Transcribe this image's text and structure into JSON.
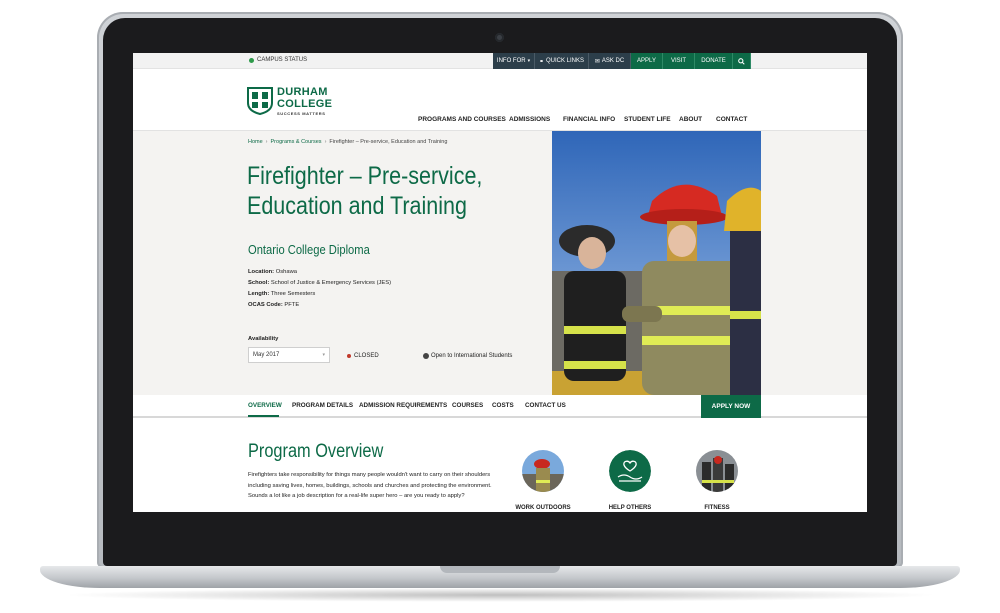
{
  "utility": {
    "campus_status": "CAMPUS STATUS",
    "info_for": "INFO FOR",
    "quick_links": "QUICK LINKS",
    "ask_dc": "ASK DC",
    "apply": "APPLY",
    "visit": "VISIT",
    "donate": "DONATE"
  },
  "logo": {
    "line1": "DURHAM",
    "line2": "COLLEGE",
    "tagline": "SUCCESS MATTERS"
  },
  "nav": {
    "items": [
      "PROGRAMS AND COURSES",
      "ADMISSIONS",
      "FINANCIAL INFO",
      "STUDENT LIFE",
      "ABOUT",
      "CONTACT"
    ]
  },
  "breadcrumb": {
    "home": "Home",
    "programs": "Programs & Courses",
    "current": "Firefighter – Pre-service, Education and Training"
  },
  "program": {
    "title_line1": "Firefighter – Pre-service,",
    "title_line2": "Education and Training",
    "credential": "Ontario College Diploma",
    "location_label": "Location:",
    "location": "Oshawa",
    "school_label": "School:",
    "school": "School of Justice & Emergency Services (JES)",
    "length_label": "Length:",
    "length": "Three Semesters",
    "ocas_label": "OCAS Code:",
    "ocas": "PFTE",
    "availability_label": "Availability",
    "availability_value": "May 2017",
    "status": "CLOSED",
    "international": "Open to International Students"
  },
  "tabs": {
    "items": [
      "OVERVIEW",
      "PROGRAM DETAILS",
      "ADMISSION REQUIREMENTS",
      "COURSES",
      "COSTS",
      "CONTACT US"
    ],
    "apply_now": "APPLY NOW"
  },
  "overview": {
    "heading": "Program Overview",
    "body": "Firefighters take responsibility for things many people wouldn't want to carry on their shoulders including saving lives, homes, buildings, schools and churches and protecting the environment. Sounds a lot like a job description for a real-life super hero – are you ready to apply?"
  },
  "features": [
    "WORK OUTDOORS",
    "HELP OTHERS",
    "FITNESS"
  ],
  "colors": {
    "brand_green": "#0d6a47",
    "utility_dark": "#2c3e4a",
    "status_closed": "#c0392b"
  }
}
